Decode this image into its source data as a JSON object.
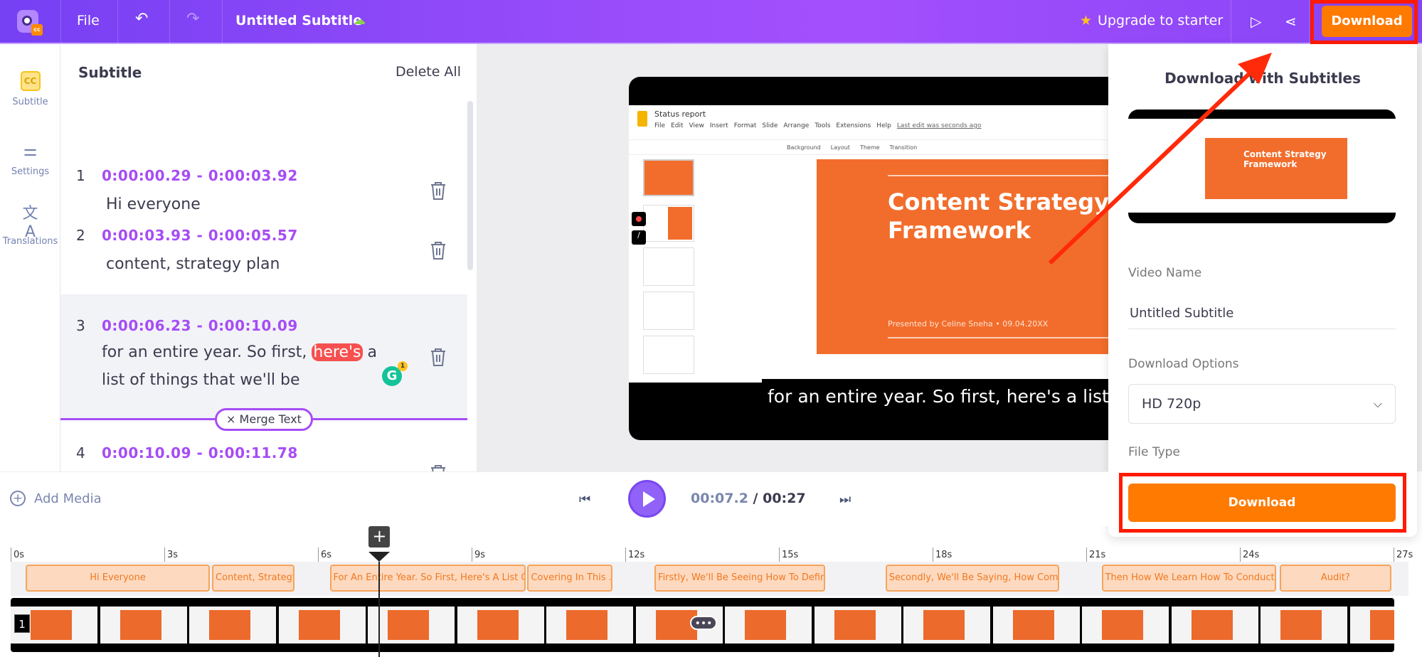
{
  "topbar": {
    "file_label": "File",
    "project_title": "Untitled Subtitle",
    "upgrade_label": "Upgrade to starter",
    "download_label": "Download",
    "accent": "#8b45f7"
  },
  "rail": {
    "items": [
      {
        "label": "Subtitle",
        "icon": "cc-icon"
      },
      {
        "label": "Settings",
        "icon": "sliders-icon"
      },
      {
        "label": "Translations",
        "icon": "translate-icon"
      }
    ]
  },
  "subtitles_panel": {
    "title": "Subtitle",
    "delete_all": "Delete All",
    "merge_label": "Merge Text",
    "grammarly_count": "1",
    "rows": [
      {
        "num": "1",
        "time": "0:00:00.29 - 0:00:03.92",
        "text": "Hi everyone"
      },
      {
        "num": "2",
        "time": "0:00:03.93 - 0:00:05.57",
        "text": "content, strategy plan"
      },
      {
        "num": "3",
        "time": "0:00:06.23 - 0:00:10.09",
        "text_before": "for an entire year. So first, ",
        "text_highlight": "here's",
        "text_after": " a list of things that we'll be"
      },
      {
        "num": "4",
        "time": "0:00:10.09 - 0:00:11.78",
        "text": ""
      }
    ]
  },
  "preview": {
    "doc_title": "Status report",
    "menu": [
      "File",
      "Edit",
      "View",
      "Insert",
      "Format",
      "Slide",
      "Arrange",
      "Tools",
      "Extensions",
      "Help"
    ],
    "last_edit": "Last edit was seconds ago",
    "toolbar_items": [
      "Background",
      "Layout",
      "Theme",
      "Transition"
    ],
    "slide_title": "Content Strategy Framework",
    "slide_subtitle": "Presented by Celine Sneha • 09.04.20XX",
    "caption": "for an entire year. So first, here's a list of things t"
  },
  "download_panel": {
    "title": "Download with Subtitles",
    "video_name_label": "Video Name",
    "video_name": "Untitled Subtitle",
    "options_label": "Download Options",
    "quality": "HD 720p",
    "file_type_label": "File Type",
    "download_label": "Download",
    "button_color": "#ff7a00"
  },
  "player": {
    "add_media": "Add Media",
    "current": "00:07.2",
    "separator": " / ",
    "total": "00:27"
  },
  "timeline": {
    "ticks": [
      "0s",
      "3s",
      "6s",
      "9s",
      "12s",
      "15s",
      "18s",
      "21s",
      "24s",
      "27s"
    ],
    "playhead_s": 7.2,
    "clip_number": "1",
    "chips": [
      {
        "label": "Hi Everyone",
        "start": 0.29,
        "end": 3.92
      },
      {
        "label": "Content, Strategy...",
        "start": 3.93,
        "end": 5.57
      },
      {
        "label": "For An Entire Year. So First, Here's A List Of ...",
        "start": 6.23,
        "end": 10.09
      },
      {
        "label": "Covering In This ...",
        "start": 10.09,
        "end": 11.78
      },
      {
        "label": "Firstly, We'll Be Seeing How To Define ...",
        "start": 12.57,
        "end": 15.93
      },
      {
        "label": "Secondly, We'll Be Saying, How Come T...",
        "start": 17.08,
        "end": 20.5
      },
      {
        "label": "Then How We Learn How To Conduct A ...",
        "start": 21.3,
        "end": 24.73
      },
      {
        "label": "Audit?",
        "start": 24.78,
        "end": 26.98
      }
    ],
    "chip_color": "#fdd9bf"
  }
}
